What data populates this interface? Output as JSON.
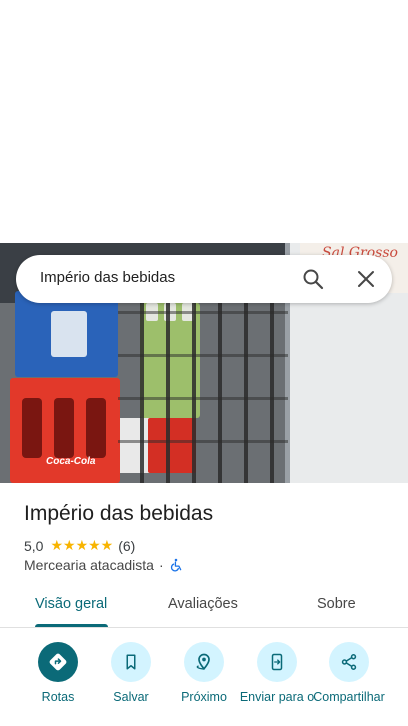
{
  "search": {
    "query": "Império das bebidas"
  },
  "photo": {
    "sign_text": "Sal Grosso",
    "crate_brand": "Coca-Cola"
  },
  "place": {
    "name": "Império das bebidas",
    "rating": "5,0",
    "stars": "★★★★★",
    "review_count": "(6)",
    "category": "Mercearia atacadista",
    "separator": "·"
  },
  "tabs": [
    {
      "label": "Visão geral",
      "active": true
    },
    {
      "label": "Avaliações",
      "active": false
    },
    {
      "label": "Sobre",
      "active": false
    }
  ],
  "actions": [
    {
      "label": "Rotas",
      "icon": "directions-icon"
    },
    {
      "label": "Salvar",
      "icon": "bookmark-icon"
    },
    {
      "label": "Próximo",
      "icon": "nearby-icon"
    },
    {
      "label": "Enviar para o",
      "icon": "send-to-phone-icon"
    },
    {
      "label": "Compartilhar",
      "icon": "share-icon"
    }
  ],
  "colors": {
    "accent": "#0b6a78",
    "action_bg": "#d3f4ff",
    "star": "#f8b400"
  }
}
